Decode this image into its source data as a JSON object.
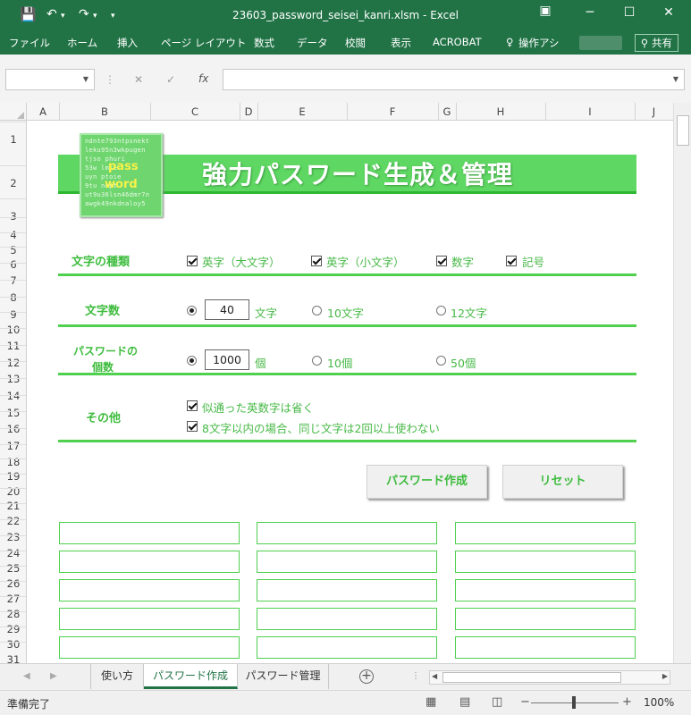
{
  "window": {
    "title": "23603_password_seisei_kanri.xlsm - Excel",
    "save_icon": "floppy-icon",
    "undo_icon": "undo-icon",
    "redo_icon": "redo-icon",
    "min": "─",
    "restore": "▭",
    "max": "☐",
    "close": "✕"
  },
  "ribbon": {
    "tabs": [
      "ファイル",
      "ホーム",
      "挿入",
      "ページ レイアウト",
      "数式",
      "データ",
      "校閲",
      "表示",
      "ACROBAT",
      "操作アシ"
    ],
    "share": "共有"
  },
  "formula": {
    "name_value": "",
    "formula_value": "",
    "fx": "fx",
    "cancel": "✕",
    "enter": "✓"
  },
  "columns": [
    "A",
    "B",
    "C",
    "D",
    "E",
    "F",
    "G",
    "H",
    "I",
    "J"
  ],
  "rows": [
    "1",
    "2",
    "3",
    "4",
    "5",
    "6",
    "7",
    "8",
    "9",
    "10",
    "11",
    "12",
    "13",
    "14",
    "15",
    "16",
    "17",
    "18",
    "19",
    "20",
    "21",
    "22",
    "23",
    "24",
    "25",
    "26",
    "27",
    "28",
    "29",
    "30",
    "31"
  ],
  "sheet": {
    "title": "強力パスワード生成＆管理",
    "logo": {
      "lines": [
        "ndnte793ntpsnekt",
        "leku95n3wkpugen",
        "tjso          phuri",
        "53w           lmte",
        "uyn           ptoie",
        "9tu           nnpt",
        "ut9u36lsn46dmr7n",
        "awgk49nkdnaloy5"
      ],
      "pass": "pass",
      "word": "word"
    },
    "char_types": {
      "label": "文字の種類",
      "options": [
        {
          "text": "英字（大文字）",
          "checked": true
        },
        {
          "text": "英字（小文字）",
          "checked": true
        },
        {
          "text": "数字",
          "checked": true
        },
        {
          "text": "記号",
          "checked": true
        }
      ]
    },
    "length": {
      "label": "文字数",
      "value": "40",
      "unit": "文字",
      "opt2": "10文字",
      "opt3": "12文字"
    },
    "count": {
      "label_1": "パスワードの",
      "label_2": "個数",
      "value": "1000",
      "unit": "個",
      "opt2": "10個",
      "opt3": "50個"
    },
    "other": {
      "label": "その他",
      "opt1": "似通った英数字は省く",
      "opt2": "8文字以内の場合、同じ文字は2回以上使わない"
    },
    "buttons": {
      "generate": "パスワード作成",
      "reset": "リセット"
    }
  },
  "sheet_tabs": [
    "使い方",
    "パスワード作成",
    "パスワード管理"
  ],
  "active_tab": "パスワード作成",
  "status": {
    "text": "準備完了",
    "zoom": "100%",
    "zoom_out": "−",
    "zoom_in": "+"
  }
}
